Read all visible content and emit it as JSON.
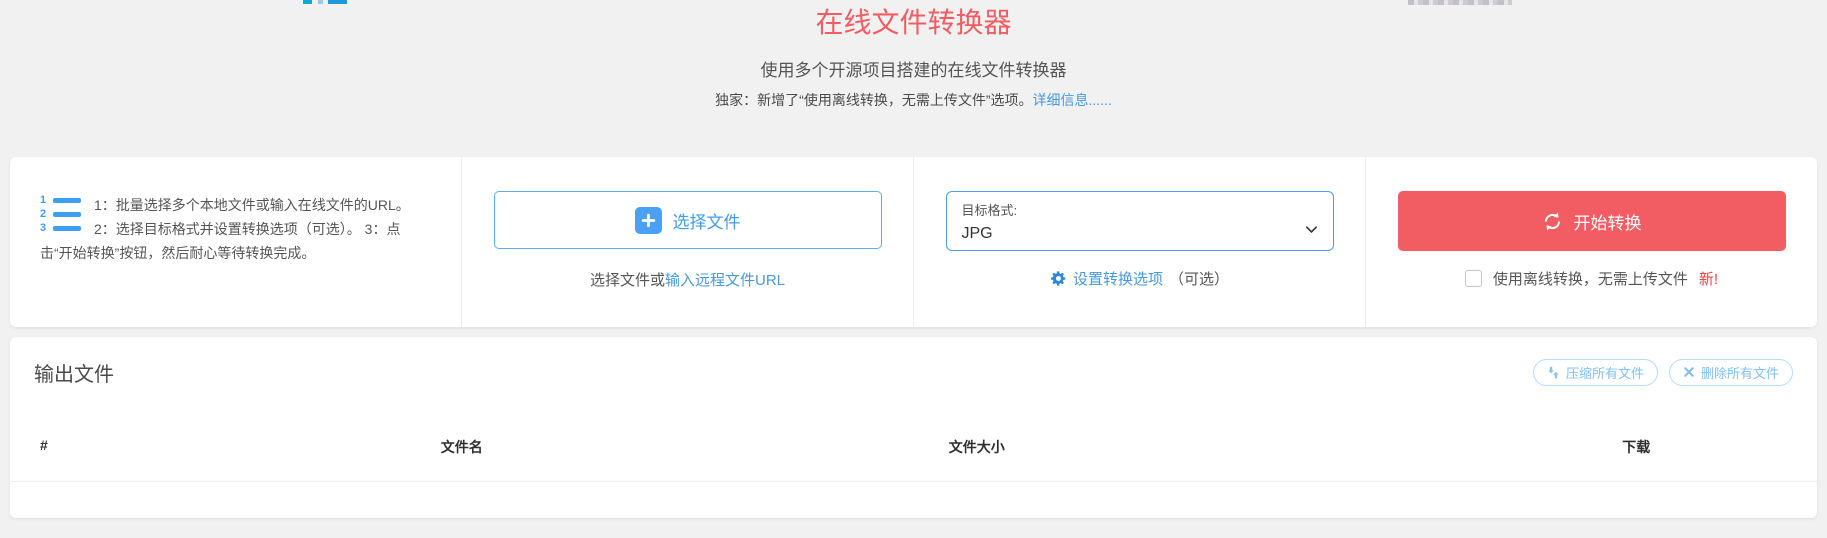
{
  "header": {
    "title": "在线文件转换器",
    "subtitle": "使用多个开源项目搭建的在线文件转换器",
    "promo_text": "独家：新增了“使用离线转换，无需上传文件”选项。",
    "promo_link": "详细信息......"
  },
  "converter": {
    "instructions": "1：批量选择多个本地文件或输入在线文件的URL。 2：选择目标格式并设置转换选项（可选）。 3：点击“开始转换”按钮，然后耐心等待转换完成。",
    "list_icon_numbers": {
      "n1": "1",
      "n2": "2",
      "n3": "3"
    },
    "choose_file_label": "选择文件",
    "file_hint_prefix": "选择文件或",
    "file_hint_link": "输入远程文件URL",
    "format_label": "目标格式:",
    "format_value": "JPG",
    "options_link": "设置转换选项",
    "options_note": "（可选）",
    "start_button": "开始转换",
    "offline_label": "使用离线转换，无需上传文件",
    "offline_badge": "新!",
    "offline_checked": false
  },
  "output": {
    "title": "输出文件",
    "compress_button": "压缩所有文件",
    "delete_button": "删除所有文件",
    "columns": [
      "#",
      "文件名",
      "文件大小",
      "下载"
    ],
    "rows": []
  },
  "colors": {
    "accent_red": "#f25c63",
    "title_red": "#f25d64",
    "link_blue": "#4898dd",
    "primary_blue": "#4aa0f5",
    "light_blue": "#7fc0f2",
    "page_background": "#f1f1f2"
  }
}
